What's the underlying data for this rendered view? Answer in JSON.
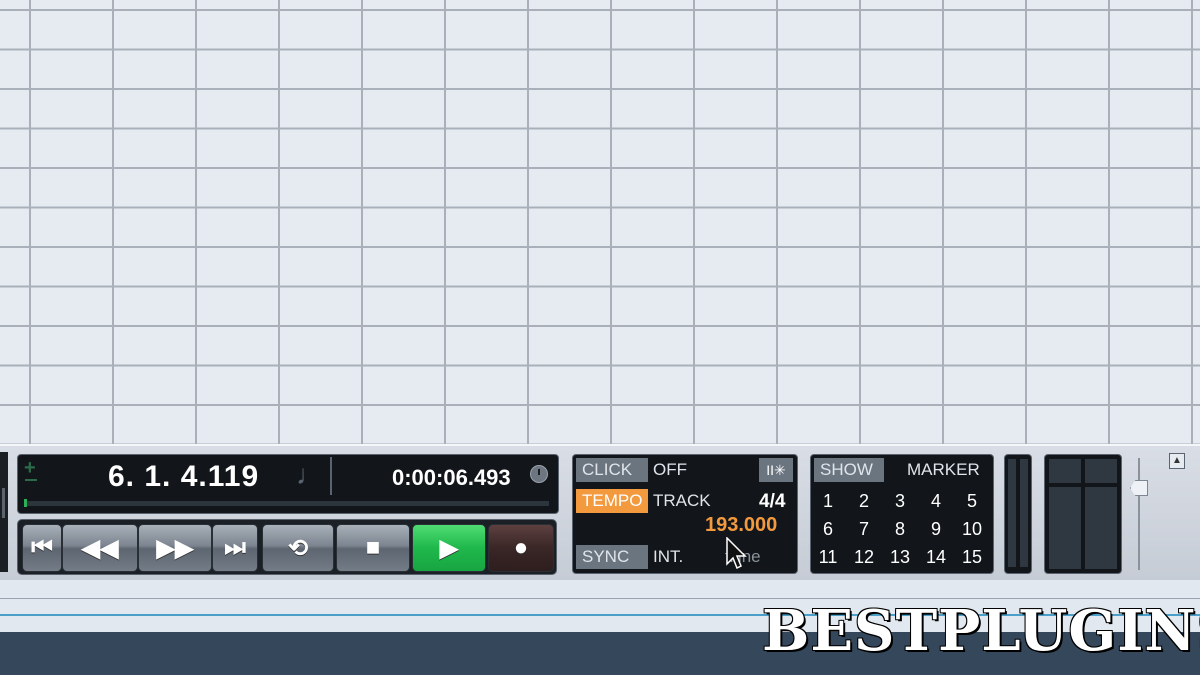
{
  "position": {
    "bars_beats": "6. 1. 4.119",
    "time": "0:00:06.493",
    "plus": "+"
  },
  "transport_buttons": [
    {
      "name": "go-to-start-button",
      "glyph": "⏮"
    },
    {
      "name": "rewind-button",
      "glyph": "◀◀"
    },
    {
      "name": "fast-forward-button",
      "glyph": "▶▶"
    },
    {
      "name": "go-to-end-button",
      "glyph": "⏭"
    },
    {
      "name": "loop-button",
      "glyph": "⟲"
    },
    {
      "name": "stop-button",
      "glyph": "■"
    },
    {
      "name": "play-button",
      "glyph": "▶"
    },
    {
      "name": "record-button",
      "glyph": "●"
    }
  ],
  "click": {
    "label": "CLICK",
    "value": "OFF",
    "settings_glyph": "II✳"
  },
  "tempo": {
    "label": "TEMPO",
    "mode": "TRACK",
    "signature": "4/4",
    "bpm": "193.000"
  },
  "sync": {
    "label": "SYNC",
    "source": "INT.",
    "status": "ffline"
  },
  "markers": {
    "show_label": "SHOW",
    "label": "MARKER",
    "numbers": [
      "1",
      "2",
      "3",
      "4",
      "5",
      "6",
      "7",
      "8",
      "9",
      "10",
      "11",
      "12",
      "13",
      "14",
      "15"
    ]
  },
  "watermark": "BESTPLUGINS",
  "colors": {
    "play_green": "#1fb84b",
    "tempo_orange": "#f39a3f",
    "bg_grid": "#e6ebf1"
  }
}
